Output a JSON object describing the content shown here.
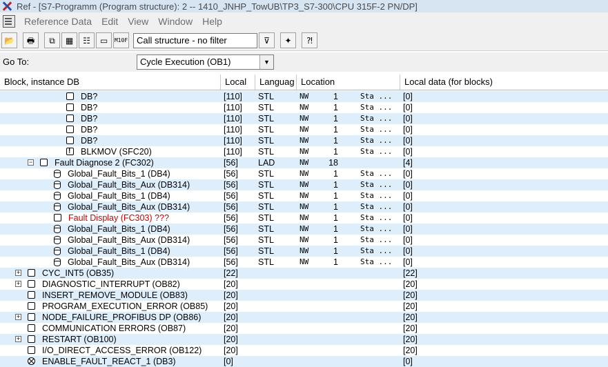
{
  "window": {
    "title": "Ref - [S7-Programm (Program structure): 2 -- 1410_JNHP_TowUB\\TP3_S7-300\\CPU 315F-2 PN/DP]"
  },
  "menu": [
    "Reference Data",
    "Edit",
    "View",
    "Window",
    "Help"
  ],
  "toolbar": {
    "buttons": [
      "open-icon",
      "print-icon",
      "cross-ref-icon",
      "assignment-icon",
      "program-structure-icon",
      "unused-symbols-icon",
      "addresses-without-symbol-icon"
    ],
    "filter_text": "Call structure - no filter",
    "extra_buttons": [
      "filter-icon",
      "new-window-icon",
      "help-icon"
    ],
    "m10_label_top": "M10",
    "m10_label_bottom": "F"
  },
  "goto": {
    "label": "Go To:",
    "selected": "Cycle Execution (OB1)"
  },
  "columns": [
    "Block, instance DB",
    "Local",
    "Languag",
    "Location",
    "Local data (for blocks)"
  ],
  "rows": [
    {
      "icon": "block",
      "indent": 96,
      "expander": "",
      "name": "DB?",
      "local": "[110]",
      "lang": "STL",
      "nw": "NW",
      "num": "1",
      "sta": "Sta ...",
      "ld": "[0]",
      "red": false
    },
    {
      "icon": "block",
      "indent": 96,
      "expander": "",
      "name": "DB?",
      "local": "[110]",
      "lang": "STL",
      "nw": "NW",
      "num": "1",
      "sta": "Sta ...",
      "ld": "[0]",
      "red": false
    },
    {
      "icon": "block",
      "indent": 96,
      "expander": "",
      "name": "DB?",
      "local": "[110]",
      "lang": "STL",
      "nw": "NW",
      "num": "1",
      "sta": "Sta ...",
      "ld": "[0]",
      "red": false
    },
    {
      "icon": "block",
      "indent": 96,
      "expander": "",
      "name": "DB?",
      "local": "[110]",
      "lang": "STL",
      "nw": "NW",
      "num": "1",
      "sta": "Sta ...",
      "ld": "[0]",
      "red": false
    },
    {
      "icon": "block",
      "indent": 96,
      "expander": "",
      "name": "DB?",
      "local": "[110]",
      "lang": "STL",
      "nw": "NW",
      "num": "1",
      "sta": "Sta ...",
      "ld": "[0]",
      "red": false
    },
    {
      "icon": "alert",
      "indent": 96,
      "expander": "",
      "name": "BLKMOV (SFC20)",
      "local": "[110]",
      "lang": "STL",
      "nw": "NW",
      "num": "1",
      "sta": "Sta ...",
      "ld": "[0]",
      "red": false
    },
    {
      "icon": "block",
      "indent": 58,
      "expander": "−",
      "name": "Fault Diagnose 2 (FC302)",
      "local": "[56]",
      "lang": "LAD",
      "nw": "NW",
      "num": "18",
      "sta": "",
      "ld": "[4]",
      "red": false
    },
    {
      "icon": "db",
      "indent": 78,
      "expander": "",
      "name": "Global_Fault_Bits_1 (DB4)",
      "local": "[56]",
      "lang": "STL",
      "nw": "NW",
      "num": "1",
      "sta": "Sta ...",
      "ld": "[0]",
      "red": false
    },
    {
      "icon": "db",
      "indent": 78,
      "expander": "",
      "name": "Global_Fault_Bits_Aux (DB314)",
      "local": "[56]",
      "lang": "STL",
      "nw": "NW",
      "num": "1",
      "sta": "Sta ...",
      "ld": "[0]",
      "red": false
    },
    {
      "icon": "db",
      "indent": 78,
      "expander": "",
      "name": "Global_Fault_Bits_1 (DB4)",
      "local": "[56]",
      "lang": "STL",
      "nw": "NW",
      "num": "1",
      "sta": "Sta ...",
      "ld": "[0]",
      "red": false
    },
    {
      "icon": "db",
      "indent": 78,
      "expander": "",
      "name": "Global_Fault_Bits_Aux (DB314)",
      "local": "[56]",
      "lang": "STL",
      "nw": "NW",
      "num": "1",
      "sta": "Sta ...",
      "ld": "[0]",
      "red": false
    },
    {
      "icon": "block",
      "indent": 78,
      "expander": "",
      "name": "Fault Display (FC303) ???",
      "local": "[56]",
      "lang": "STL",
      "nw": "NW",
      "num": "1",
      "sta": "Sta ...",
      "ld": "[0]",
      "red": true
    },
    {
      "icon": "db",
      "indent": 78,
      "expander": "",
      "name": "Global_Fault_Bits_1 (DB4)",
      "local": "[56]",
      "lang": "STL",
      "nw": "NW",
      "num": "1",
      "sta": "Sta ...",
      "ld": "[0]",
      "red": false
    },
    {
      "icon": "db",
      "indent": 78,
      "expander": "",
      "name": "Global_Fault_Bits_Aux (DB314)",
      "local": "[56]",
      "lang": "STL",
      "nw": "NW",
      "num": "1",
      "sta": "Sta ...",
      "ld": "[0]",
      "red": false
    },
    {
      "icon": "db",
      "indent": 78,
      "expander": "",
      "name": "Global_Fault_Bits_1 (DB4)",
      "local": "[56]",
      "lang": "STL",
      "nw": "NW",
      "num": "1",
      "sta": "Sta ...",
      "ld": "[0]",
      "red": false
    },
    {
      "icon": "db",
      "indent": 78,
      "expander": "",
      "name": "Global_Fault_Bits_Aux (DB314)",
      "local": "[56]",
      "lang": "STL",
      "nw": "NW",
      "num": "1",
      "sta": "Sta ...",
      "ld": "[0]",
      "red": false
    },
    {
      "icon": "block",
      "indent": 40,
      "expander": "+",
      "name": "CYC_INT5 (OB35)",
      "local": "[22]",
      "lang": "",
      "nw": "",
      "num": "",
      "sta": "",
      "ld": "[22]",
      "red": false
    },
    {
      "icon": "block",
      "indent": 40,
      "expander": "+",
      "name": "DIAGNOSTIC_INTERRUPT (OB82)",
      "local": "[20]",
      "lang": "",
      "nw": "",
      "num": "",
      "sta": "",
      "ld": "[20]",
      "red": false
    },
    {
      "icon": "block",
      "indent": 40,
      "expander": "",
      "name": "INSERT_REMOVE_MODULE (OB83)",
      "local": "[20]",
      "lang": "",
      "nw": "",
      "num": "",
      "sta": "",
      "ld": "[20]",
      "red": false
    },
    {
      "icon": "block",
      "indent": 40,
      "expander": "",
      "name": "PROGRAM_EXECUTION_ERROR (OB85)",
      "local": "[20]",
      "lang": "",
      "nw": "",
      "num": "",
      "sta": "",
      "ld": "[20]",
      "red": false
    },
    {
      "icon": "block",
      "indent": 40,
      "expander": "+",
      "name": "NODE_FAILURE_PROFIBUS DP (OB86)",
      "local": "[20]",
      "lang": "",
      "nw": "",
      "num": "",
      "sta": "",
      "ld": "[20]",
      "red": false
    },
    {
      "icon": "block",
      "indent": 40,
      "expander": "",
      "name": "COMMUNICATION ERRORS (OB87)",
      "local": "[20]",
      "lang": "",
      "nw": "",
      "num": "",
      "sta": "",
      "ld": "[20]",
      "red": false
    },
    {
      "icon": "block",
      "indent": 40,
      "expander": "+",
      "name": "RESTART (OB100)",
      "local": "[20]",
      "lang": "",
      "nw": "",
      "num": "",
      "sta": "",
      "ld": "[20]",
      "red": false
    },
    {
      "icon": "block",
      "indent": 40,
      "expander": "",
      "name": "I/O_DIRECT_ACCESS_ERROR (OB122)",
      "local": "[20]",
      "lang": "",
      "nw": "",
      "num": "",
      "sta": "",
      "ld": "[20]",
      "red": false
    },
    {
      "icon": "x",
      "indent": 40,
      "expander": "",
      "name": "ENABLE_FAULT_REACT_1 (DB3)",
      "local": "[0]",
      "lang": "",
      "nw": "",
      "num": "",
      "sta": "",
      "ld": "[0]",
      "red": false
    }
  ]
}
